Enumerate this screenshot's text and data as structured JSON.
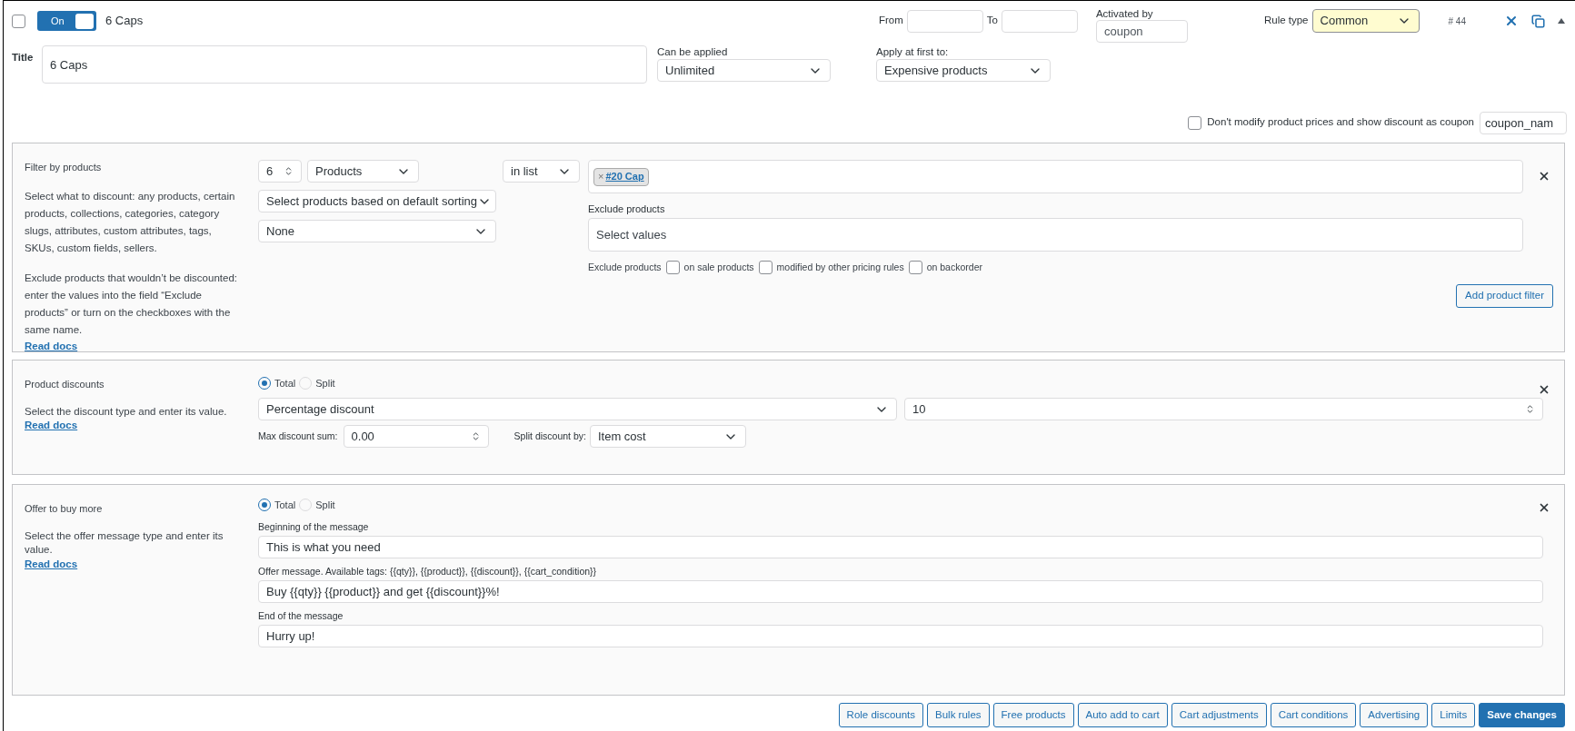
{
  "header": {
    "select_checked": false,
    "toggle": {
      "label": "On",
      "on": true
    },
    "rule_name": "6 Caps",
    "from_label": "From",
    "to_label": "To",
    "activated_by_label": "Activated by",
    "activated_by_value": "coupon",
    "rule_type_label": "Rule type",
    "rule_type_value": "Common",
    "rule_id": "# 44"
  },
  "title": {
    "label": "Title",
    "value": "6 Caps"
  },
  "can_be_applied": {
    "label": "Can be applied",
    "value": "Unlimited"
  },
  "apply_at_first": {
    "label": "Apply at first to:",
    "value": "Expensive products"
  },
  "coupon_option": {
    "checked": false,
    "label": "Don't modify product prices and show discount as coupon",
    "value": "coupon_nam"
  },
  "filter": {
    "title": "Filter by products",
    "description": [
      "Select what to discount: any products, certain products, collections, categories, category slugs, attributes, custom attributes, tags, SKUs, custom fields, sellers.",
      "Exclude products that wouldn’t be discounted: enter the values into the field “Exclude products” or turn on the checkboxes with the same name."
    ],
    "read_docs": "Read docs",
    "qty": "6",
    "type": "Products",
    "sorting": "Select products based on default sorting",
    "secondary": "None",
    "operator": "in list",
    "tags": [
      {
        "label": "#20 Cap",
        "remove": "×"
      }
    ],
    "exclude_label": "Exclude products",
    "exclude_placeholder": "Select values",
    "exclude_checks_label": "Exclude products",
    "checks": [
      {
        "label": "on sale products",
        "checked": false
      },
      {
        "label": "modified by other pricing rules",
        "checked": false
      },
      {
        "label": "on backorder",
        "checked": false
      }
    ],
    "add_button": "Add product filter"
  },
  "discounts": {
    "title": "Product discounts",
    "description": "Select the discount type and enter its value.",
    "read_docs": "Read docs",
    "modes": [
      {
        "label": "Total",
        "selected": true
      },
      {
        "label": "Split",
        "selected": false
      }
    ],
    "type": "Percentage discount",
    "value": "10",
    "max_label": "Max discount sum:",
    "max_value": "0.00",
    "split_label": "Split discount by:",
    "split_value": "Item cost"
  },
  "offer": {
    "title": "Offer to buy more",
    "description": "Select the offer message type and enter its value.",
    "read_docs": "Read docs",
    "modes": [
      {
        "label": "Total",
        "selected": true
      },
      {
        "label": "Split",
        "selected": false
      }
    ],
    "fields": [
      {
        "label": "Beginning of the message",
        "value": "This is what you need"
      },
      {
        "label": "Offer message. Available tags: {{qty}}, {{product}}, {{discount}}, {{cart_condition}}",
        "value": "Buy {{qty}} {{product}} and get {{discount}}%!"
      },
      {
        "label": "End of the message",
        "value": "Hurry up!"
      }
    ]
  },
  "footer_buttons": [
    {
      "label": "Role discounts",
      "primary": false
    },
    {
      "label": "Bulk rules",
      "primary": false
    },
    {
      "label": "Free products",
      "primary": false
    },
    {
      "label": "Auto add to cart",
      "primary": false
    },
    {
      "label": "Cart adjustments",
      "primary": false
    },
    {
      "label": "Cart conditions",
      "primary": false
    },
    {
      "label": "Advertising",
      "primary": false
    },
    {
      "label": "Limits",
      "primary": false
    },
    {
      "label": "Save changes",
      "primary": true
    }
  ]
}
